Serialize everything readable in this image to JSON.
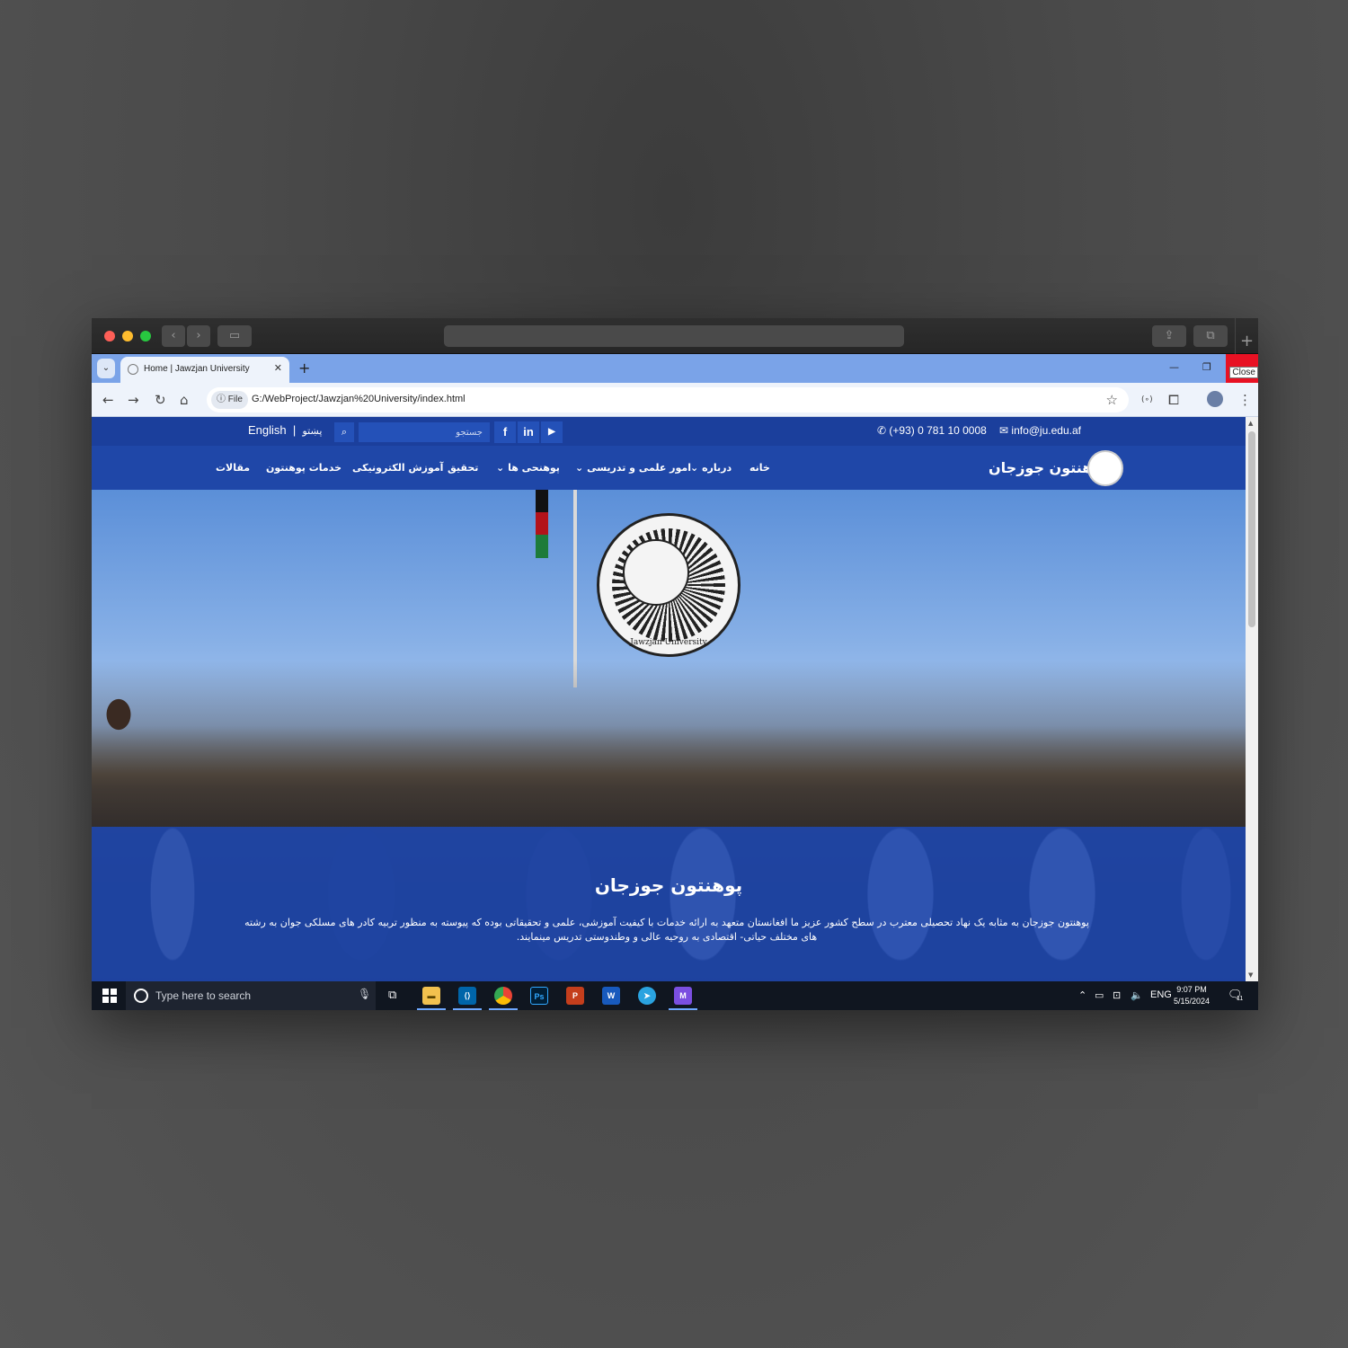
{
  "browser": {
    "tab_title": "Home | Jawzjan University",
    "tab_close": "✕",
    "new_tab": "+",
    "file_chip": "File",
    "url": "G:/WebProject/Jawzjan%20University/index.html",
    "close_tooltip": "Close",
    "minimize": "—",
    "restore": "❐"
  },
  "site": {
    "lang_english": "English",
    "lang_separator": "|",
    "lang_pashto": "پښتو",
    "search_placeholder": "جستجو",
    "social": [
      "f",
      "in",
      "▶"
    ],
    "phone": "(+93) 0 781 10 0008",
    "email": "info@ju.edu.af",
    "brand": "پوهنتون جوزجان",
    "nav": {
      "home": "خانه",
      "about": "درباره",
      "academic": "امور علمی و تدریسی",
      "faculties": "پوهنحی ها",
      "research": "تحقیق",
      "elearning": "آموزش الکترونیکی",
      "services": "خدمات پوهنتون",
      "articles": "مقالات"
    }
  },
  "hero": {
    "seal_text": "Jawzjan University",
    "title": "پوهنتون جوزجان",
    "text": "پوهنتون جوزجان به مثابه یک نهاد تحصیلی معترب در سطح کشور عزیز ما افغانستان متعهد به ارائه خدمات با کیفیت آموزشی، علمی و تحقیقاتی بوده که پیوسته به منظور تربیه کادر های مسلکی جوان به رشته های مختلف حیاتی- اقتصادی به روحیه عالی و وطندوستی تدریس مینمایند."
  },
  "taskbar": {
    "search_placeholder": "Type here to search",
    "lang": "ENG",
    "time": "9:07 PM",
    "date": "5/15/2024",
    "notification_count": "11"
  },
  "colors": {
    "site_primary": "#1f47a8",
    "close_red": "#e81123",
    "tab_strip": "#7aa3e8"
  }
}
